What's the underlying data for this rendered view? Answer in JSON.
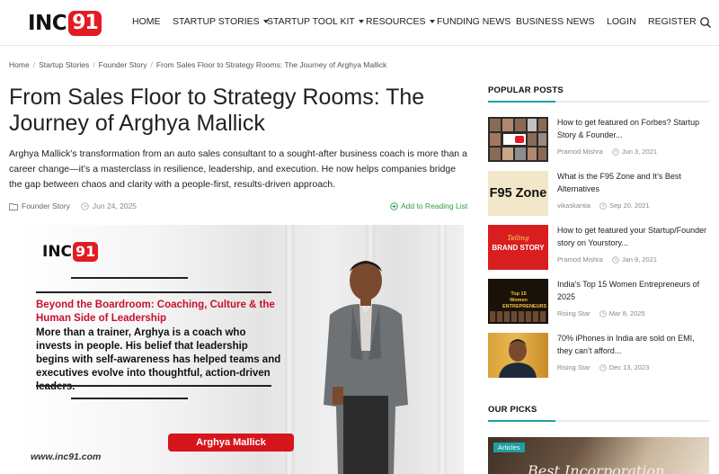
{
  "site": {
    "logo_text": "INC",
    "logo_badge": "91"
  },
  "nav": {
    "home": "HOME",
    "startup_stories": "STARTUP STORIES",
    "startup_tool_kit": "STARTUP TOOL KIT",
    "resources": "RESOURCES",
    "funding_news": "FUNDING NEWS",
    "business_news": "BUSINESS NEWS",
    "login": "LOGIN",
    "register": "REGISTER"
  },
  "breadcrumb": [
    "Home",
    "Startup Stories",
    "Founder Story",
    "From Sales Floor to Strategy Rooms: The Journey of Arghya Mallick"
  ],
  "article": {
    "title": "From Sales Floor to Strategy Rooms: The Journey of Arghya Mallick",
    "excerpt": "Arghya Mallick’s transformation from an auto sales consultant to a sought-after business coach is more than a career change—it’s a masterclass in resilience, leadership, and execution. He now helps companies bridge the gap between chaos and clarity with a people-first, results-driven approach.",
    "category": "Founder Story",
    "date": "Jun 24, 2025",
    "reading_list": "Add to Reading List"
  },
  "hero": {
    "logo_text": "INC",
    "logo_badge": "91",
    "heading": "Beyond the Boardroom: Coaching, Culture & the Human Side of Leadership",
    "body": "More than a trainer, Arghya is a coach who invests in people. His belief that leadership begins with self-awareness has helped teams and executives evolve into thoughtful, action-driven leaders.",
    "name": "Arghya Mallick",
    "url": "www.inc91.com"
  },
  "sidebar": {
    "popular_heading": "POPULAR POSTS",
    "posts": [
      {
        "title": "How to get featured on Forbes? Startup Story & Founder...",
        "author": "Pramod Mishra",
        "date": "Jun 3, 2021"
      },
      {
        "title": "What is the F95 Zone and It’s Best Alternatives",
        "author": "vikaskantia",
        "date": "Sep 20, 2021",
        "thumb_text": "F95 Zone"
      },
      {
        "title": "How to get featured your Startup/Founder story on Yourstory...",
        "author": "Pramod Mishra",
        "date": "Jan 9, 2021",
        "thumb_top": "Telling",
        "thumb_text": "BRAND STORY"
      },
      {
        "title": "India’s Top 15 Women Entrepreneurs of 2025",
        "author": "Rising Star",
        "date": "Mar 8, 2025",
        "thumb_text": "Top 15 Women ENTREPRENEURS"
      },
      {
        "title": "70% iPhones in India are sold on EMI, they can’t afford...",
        "author": "Rising Star",
        "date": "Dec 13, 2023"
      }
    ],
    "picks_heading": "OUR PICKS",
    "pick": {
      "badge": "Articles",
      "text": "Best Incorporation"
    }
  },
  "colors": {
    "brand_red": "#e31b23",
    "accent_teal": "#1f9fa0",
    "reading_green": "#2e9e3d"
  }
}
